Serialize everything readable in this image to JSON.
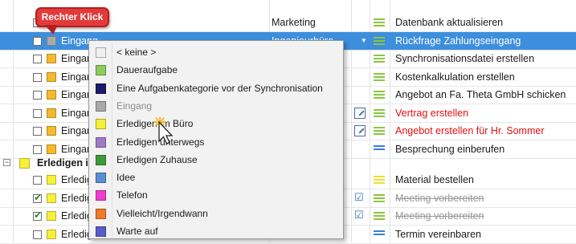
{
  "callout": {
    "label": "Rechter Klick"
  },
  "rows": [
    {
      "id": "r1",
      "checked": false,
      "category": "",
      "category_color": "#f5b92e",
      "sub": "Marketing",
      "prio": "green",
      "task": "Datenbank aktualisieren",
      "style": ""
    },
    {
      "id": "r2",
      "checked": false,
      "category": "Eingang",
      "category_color": "#a9a9a9",
      "sub": "Ingenieurbüro",
      "prio": "green",
      "task": "Rückfrage Zahlungseingang",
      "style": "selected"
    },
    {
      "id": "r3",
      "checked": false,
      "category": "Eingang",
      "category_color": "#f5b92e",
      "sub": "",
      "prio": "green",
      "task": "Synchronisationsdatei erstellen",
      "style": ""
    },
    {
      "id": "r4",
      "checked": false,
      "category": "Eingang",
      "category_color": "#f5b92e",
      "sub": "",
      "prio": "green",
      "task": "Kostenkalkulation erstellen",
      "style": ""
    },
    {
      "id": "r5",
      "checked": false,
      "category": "Eingang",
      "category_color": "#f5b92e",
      "sub": "",
      "prio": "green",
      "task": "Angebot an Fa. Theta GmbH schicken",
      "style": ""
    },
    {
      "id": "r6",
      "checked": false,
      "category": "Eingang",
      "category_color": "#f5b92e",
      "sub": "",
      "prio": "green",
      "task": "Vertrag erstellen",
      "style": "red",
      "icon": "edit"
    },
    {
      "id": "r7",
      "checked": false,
      "category": "Eingang",
      "category_color": "#f5b92e",
      "sub": "",
      "prio": "green",
      "task": "Angebot erstellen für Hr. Sommer",
      "style": "red",
      "icon": "edit"
    },
    {
      "id": "r8",
      "checked": false,
      "category": "Eingang",
      "category_color": "#f5b92e",
      "sub": "",
      "prio": "blue",
      "task": "Besprechung einberufen",
      "style": ""
    }
  ],
  "group": {
    "label": "Erledigen im Büro",
    "color": "#f6f03a"
  },
  "group_rows": [
    {
      "id": "g1",
      "checked": false,
      "category": "Erledigen im Büro",
      "category_color": "#f6f03a",
      "prio": "yellow",
      "task": "Material bestellen",
      "style": ""
    },
    {
      "id": "g2",
      "checked": true,
      "category": "Erledigen im Büro",
      "category_color": "#f6f03a",
      "prio": "green",
      "task": "Meeting vorbereiten",
      "style": "strike",
      "icon": "check"
    },
    {
      "id": "g3",
      "checked": true,
      "category": "Erledigen im Büro",
      "category_color": "#f6f03a",
      "prio": "green",
      "task": "Meeting vorbereiten",
      "style": "strike",
      "icon": "check"
    },
    {
      "id": "g4",
      "checked": false,
      "category": "Erledigen im Büro",
      "category_color": "#f6f03a",
      "prio": "blue",
      "task": "Termin vereinbaren",
      "style": ""
    }
  ],
  "menu": {
    "items": [
      {
        "label": "< keine >",
        "color": "#f0f0f0",
        "disabled": false
      },
      {
        "label": "Daueraufgabe",
        "color": "#8ccc5c",
        "disabled": false
      },
      {
        "label": "Eine Aufgabenkategorie vor der Synchronisation",
        "color": "#1a1a6e",
        "disabled": false
      },
      {
        "label": "Eingang",
        "color": "#a9a9a9",
        "disabled": true
      },
      {
        "label": "Erledigen im Büro",
        "color": "#f6f03a",
        "disabled": false
      },
      {
        "label": "Erledigen unterwegs",
        "color": "#a07ac8",
        "disabled": false
      },
      {
        "label": "Erledigen Zuhause",
        "color": "#3c9a3c",
        "disabled": false
      },
      {
        "label": "Idee",
        "color": "#5b8ed6",
        "disabled": false
      },
      {
        "label": "Telefon",
        "color": "#f03ccf",
        "disabled": false
      },
      {
        "label": "Vielleicht/Irgendwann",
        "color": "#f07a2a",
        "disabled": false
      },
      {
        "label": "Warte auf",
        "color": "#5a5ac8",
        "disabled": false
      }
    ]
  },
  "colors": {
    "selection": "#3d8fdd",
    "prio_green": "#8ac640",
    "prio_yellow": "#f0e030",
    "prio_blue": "#3a7fd6",
    "callout": "#e23a3a"
  },
  "icons": {
    "cursor": "mouse-pointer-icon",
    "expander": "collapse-icon"
  }
}
